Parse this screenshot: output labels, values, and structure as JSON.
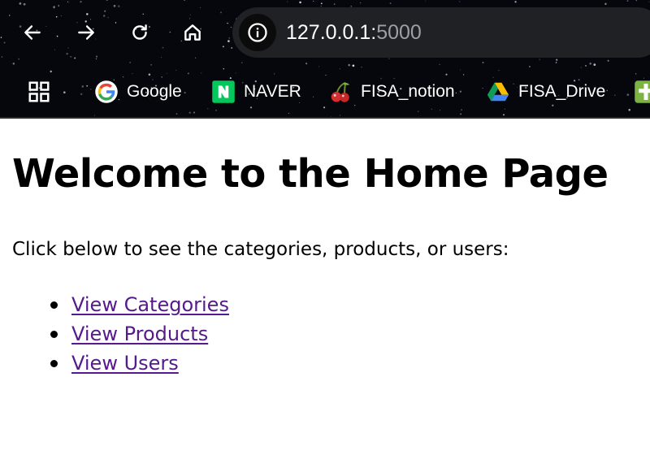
{
  "browser": {
    "url_host": "127.0.0.1:",
    "url_port": "5000",
    "bookmarks": [
      {
        "label": "Google",
        "icon": "google-icon"
      },
      {
        "label": "NAVER",
        "icon": "naver-icon"
      },
      {
        "label": "FISA_notion",
        "icon": "cherry-icon"
      },
      {
        "label": "FISA_Drive",
        "icon": "google-drive-icon"
      }
    ],
    "colors": {
      "chrome_bg": "#05070c",
      "omnibox_bg": "#202124",
      "naver_green": "#03c75a"
    }
  },
  "page": {
    "title": "Welcome to the Home Page",
    "intro": "Click below to see the categories, products, or users:",
    "links": [
      {
        "label": "View Categories"
      },
      {
        "label": "View Products"
      },
      {
        "label": "View Users"
      }
    ],
    "link_color": "#551a8b"
  }
}
